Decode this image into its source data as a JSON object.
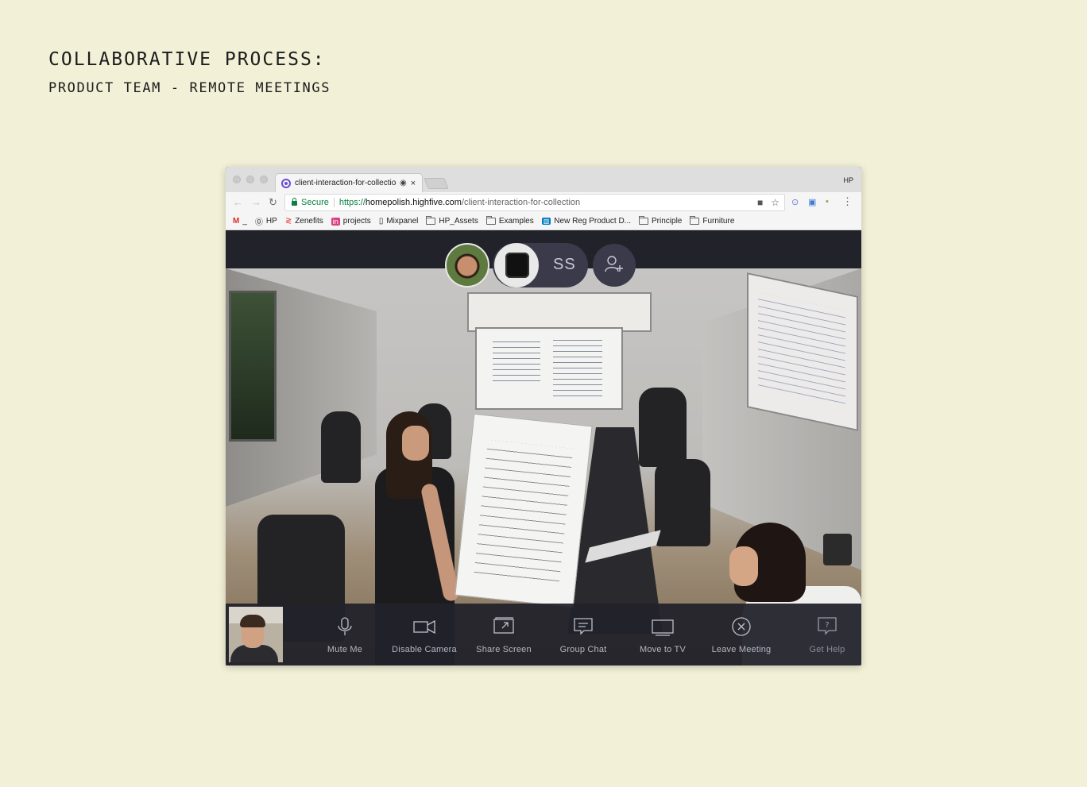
{
  "heading": {
    "title": "COLLABORATIVE PROCESS:",
    "subtitle": "PRODUCT TEAM - REMOTE MEETINGS"
  },
  "browser": {
    "tab": {
      "title": "client-interaction-for-collection",
      "recording_icon": "recording-dot-icon",
      "close": "×"
    },
    "profile_label": "HP",
    "address": {
      "secure_label": "Secure",
      "scheme": "https://",
      "host": "homepolish.highfive.com",
      "path": "/client-interaction-for-collection"
    },
    "bookmarks": [
      {
        "icon": "gmail-icon",
        "label": "_"
      },
      {
        "icon": "hp-icon",
        "label": "HP"
      },
      {
        "icon": "zenefits-icon",
        "label": "Zenefits"
      },
      {
        "icon": "invision-icon",
        "label": "projects"
      },
      {
        "icon": "page-icon",
        "label": "Mixpanel"
      },
      {
        "icon": "folder-icon",
        "label": "HP_Assets"
      },
      {
        "icon": "folder-icon",
        "label": "Examples"
      },
      {
        "icon": "trello-icon",
        "label": "New Reg Product D..."
      },
      {
        "icon": "folder-icon",
        "label": "Principle"
      },
      {
        "icon": "folder-icon",
        "label": "Furniture"
      }
    ]
  },
  "meeting": {
    "participants": {
      "initials": "SS"
    },
    "controls": [
      {
        "label": "Mute Me",
        "icon": "microphone-icon"
      },
      {
        "label": "Disable Camera",
        "icon": "camera-icon"
      },
      {
        "label": "Share Screen",
        "icon": "share-screen-icon"
      },
      {
        "label": "Group Chat",
        "icon": "chat-icon"
      },
      {
        "label": "Move to TV",
        "icon": "tv-icon"
      },
      {
        "label": "Leave Meeting",
        "icon": "close-circle-icon"
      },
      {
        "label": "Get Help",
        "icon": "help-icon"
      }
    ]
  }
}
